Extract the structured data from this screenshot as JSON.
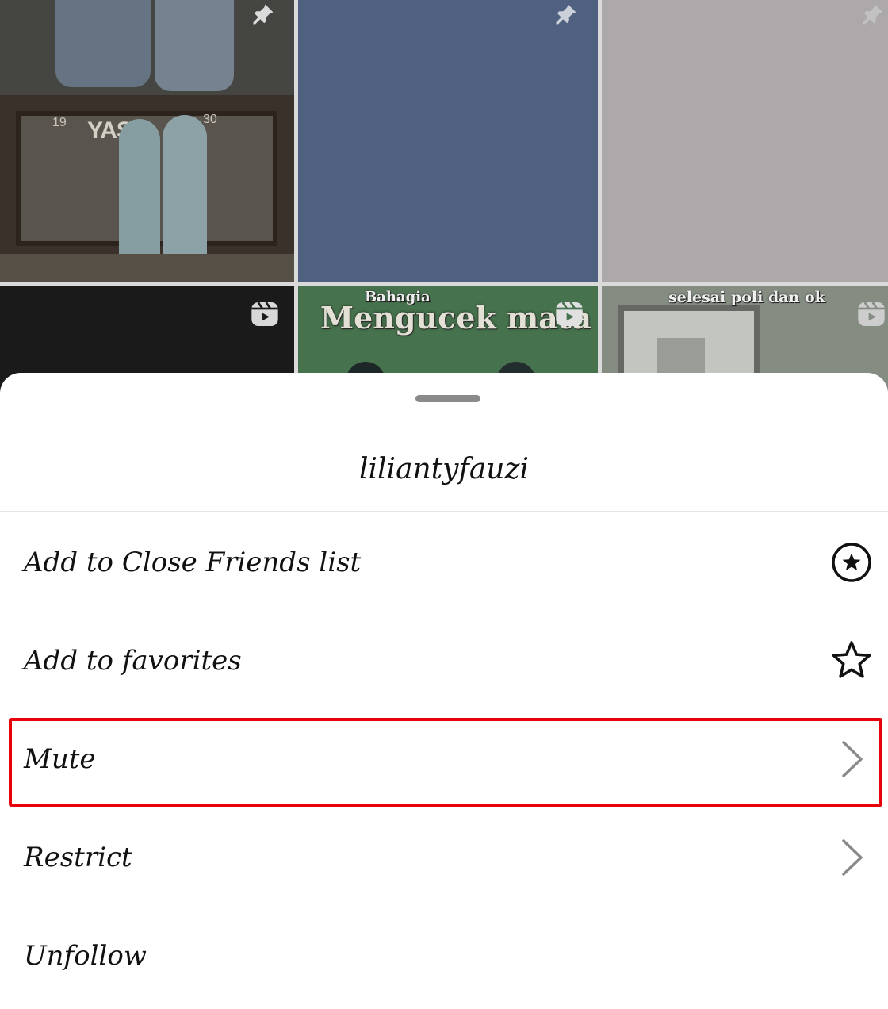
{
  "grid": {
    "tile4_icon": "reels-icon",
    "tile5_overlay_top": "Bahagia",
    "tile5_overlay_main": "Mengucek mata",
    "tile6_overlay": "selesai poli dan ok",
    "tile1_sign": "YAS",
    "tile1_num_left": "19",
    "tile1_num_right": "30"
  },
  "sheet": {
    "title": "liliantyfauzi",
    "items": [
      {
        "label": "Add to Close Friends list",
        "icon": "close-friends-star-circle-icon"
      },
      {
        "label": "Add to favorites",
        "icon": "star-outline-icon"
      },
      {
        "label": "Mute",
        "icon": "chevron-right-icon"
      },
      {
        "label": "Restrict",
        "icon": "chevron-right-icon"
      },
      {
        "label": "Unfollow",
        "icon": ""
      }
    ]
  },
  "colors": {
    "highlight": "#e8000b",
    "text": "#111111",
    "handle": "#8a8a8a"
  }
}
